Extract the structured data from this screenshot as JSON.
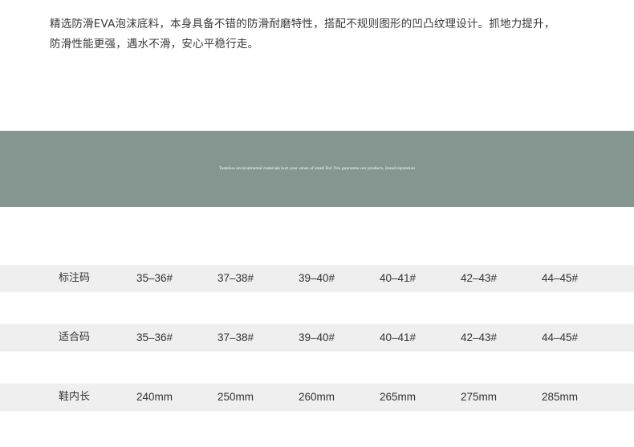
{
  "intro": {
    "line1": "精选防滑EVA泡沫底料，本身具备不错的防滑耐磨特性，搭配不规则图形的凹凸纹理设计。抓地力提升，",
    "line2": "防滑性能更强，遇水不滑，安心平稳行走。"
  },
  "banner": {
    "text": "Tasteless environmental materials hurt your sense of smell Ru! You guarantee our products, brand reputation",
    "color": "#85958f"
  },
  "size_table": {
    "rows": [
      {
        "label": "标注码",
        "values": [
          "35–36#",
          "37–38#",
          "39–40#",
          "40–41#",
          "42–43#",
          "44–45#"
        ]
      },
      {
        "label": "适合码",
        "values": [
          "35–36#",
          "37–38#",
          "39–40#",
          "40–41#",
          "42–43#",
          "44–45#"
        ]
      },
      {
        "label": "鞋内长",
        "values": [
          "240mm",
          "250mm",
          "260mm",
          "265mm",
          "275mm",
          "285mm"
        ]
      }
    ],
    "row_color": "#efefef"
  }
}
